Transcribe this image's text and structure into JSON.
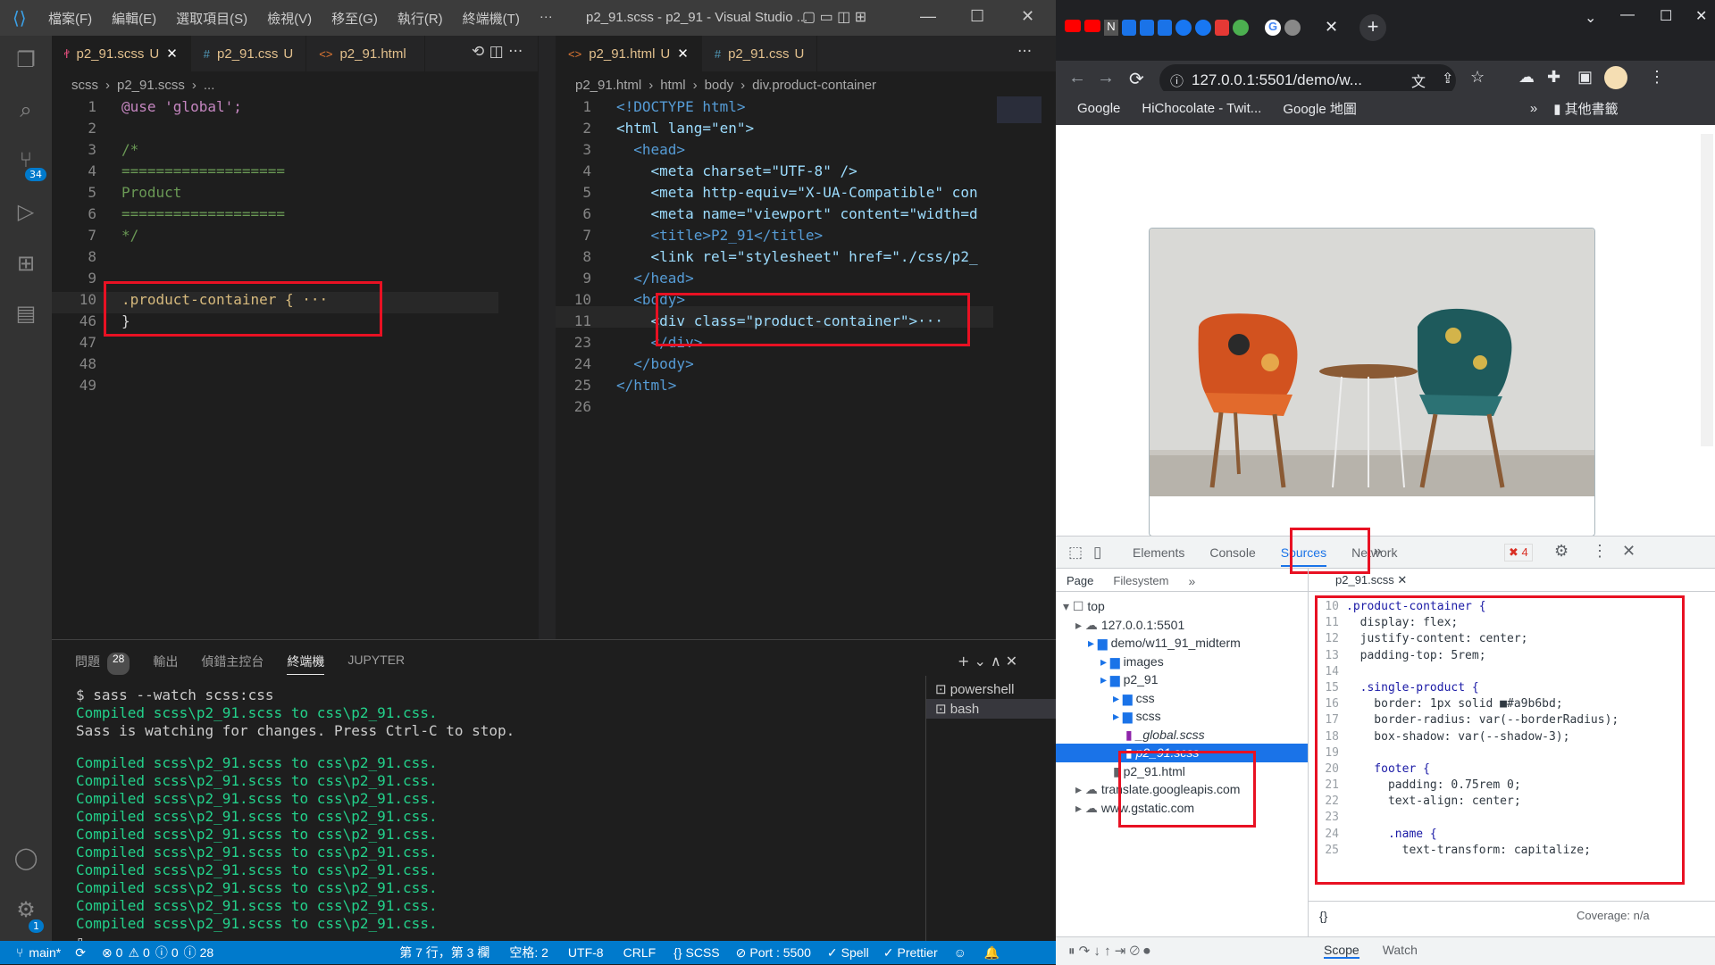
{
  "vscode": {
    "menu": [
      "檔案(F)",
      "編輯(E)",
      "選取項目(S)",
      "檢視(V)",
      "移至(G)",
      "執行(R)",
      "終端機(T)",
      "···"
    ],
    "title": "p2_91.scss - p2_91 - Visual Studio ...",
    "scm_badge": "34",
    "settings_badge": "1",
    "left_tabs": [
      {
        "icon": "ꬷ",
        "label": "p2_91.scss",
        "suffix": "U"
      },
      {
        "icon": "#",
        "label": "p2_91.css",
        "suffix": "U"
      },
      {
        "icon": "<>",
        "label": "p2_91.html",
        "suffix": ""
      }
    ],
    "right_tabs": [
      {
        "icon": "<>",
        "label": "p2_91.html",
        "suffix": "U"
      },
      {
        "icon": "#",
        "label": "p2_91.css",
        "suffix": "U"
      }
    ],
    "left_breadcrumb": [
      "scss",
      "p2_91.scss",
      "..."
    ],
    "right_breadcrumb": [
      "p2_91.html",
      "html",
      "body",
      "div.product-container"
    ],
    "left_lines": [
      {
        "n": "1",
        "t": "@use 'global';"
      },
      {
        "n": "2",
        "t": ""
      },
      {
        "n": "3",
        "t": "/*"
      },
      {
        "n": "4",
        "t": "==================="
      },
      {
        "n": "5",
        "t": "Product"
      },
      {
        "n": "6",
        "t": "==================="
      },
      {
        "n": "7",
        "t": "*/"
      },
      {
        "n": "8",
        "t": ""
      },
      {
        "n": "9",
        "t": ""
      },
      {
        "n": "10",
        "t": ".product-container { ···"
      },
      {
        "n": "46",
        "t": "}"
      },
      {
        "n": "47",
        "t": ""
      },
      {
        "n": "48",
        "t": ""
      },
      {
        "n": "49",
        "t": ""
      }
    ],
    "right_lines": [
      {
        "n": "1",
        "t": "<!DOCTYPE html>"
      },
      {
        "n": "2",
        "t": "<html lang=\"en\">"
      },
      {
        "n": "3",
        "t": "  <head>"
      },
      {
        "n": "4",
        "t": "    <meta charset=\"UTF-8\" />"
      },
      {
        "n": "5",
        "t": "    <meta http-equiv=\"X-UA-Compatible\" con"
      },
      {
        "n": "6",
        "t": "    <meta name=\"viewport\" content=\"width=d"
      },
      {
        "n": "7",
        "t": "    <title>P2_91</title>"
      },
      {
        "n": "8",
        "t": "    <link rel=\"stylesheet\" href=\"./css/p2_"
      },
      {
        "n": "9",
        "t": "  </head>"
      },
      {
        "n": "10",
        "t": "  <body>"
      },
      {
        "n": "11",
        "t": "    <div class=\"product-container\">···"
      },
      {
        "n": "23",
        "t": "    </div>"
      },
      {
        "n": "24",
        "t": "  </body>"
      },
      {
        "n": "25",
        "t": "</html>"
      },
      {
        "n": "26",
        "t": ""
      }
    ],
    "panel_tabs": [
      "問題",
      "輸出",
      "偵錯主控台",
      "終端機",
      "JUPYTER"
    ],
    "problems_count": "28",
    "terminal_lines": [
      {
        "t": "$ sass --watch scss:css",
        "c": "white"
      },
      {
        "t": "Compiled scss\\p2_91.scss to css\\p2_91.css.",
        "c": "green"
      },
      {
        "t": "Sass is watching for changes. Press Ctrl-C to stop.",
        "c": "white"
      },
      {
        "t": "",
        "c": "white"
      },
      {
        "t": "Compiled scss\\p2_91.scss to css\\p2_91.css.",
        "c": "green"
      },
      {
        "t": "Compiled scss\\p2_91.scss to css\\p2_91.css.",
        "c": "green"
      },
      {
        "t": "Compiled scss\\p2_91.scss to css\\p2_91.css.",
        "c": "green"
      },
      {
        "t": "Compiled scss\\p2_91.scss to css\\p2_91.css.",
        "c": "green"
      },
      {
        "t": "Compiled scss\\p2_91.scss to css\\p2_91.css.",
        "c": "green"
      },
      {
        "t": "Compiled scss\\p2_91.scss to css\\p2_91.css.",
        "c": "green"
      },
      {
        "t": "Compiled scss\\p2_91.scss to css\\p2_91.css.",
        "c": "green"
      },
      {
        "t": "Compiled scss\\p2_91.scss to css\\p2_91.css.",
        "c": "green"
      },
      {
        "t": "Compiled scss\\p2_91.scss to css\\p2_91.css.",
        "c": "green"
      },
      {
        "t": "Compiled scss\\p2_91.scss to css\\p2_91.css.",
        "c": "green"
      }
    ],
    "terminals": [
      "powershell",
      "bash"
    ],
    "status": {
      "branch": "main*",
      "errors": "0",
      "warnings": "0",
      "info": "0",
      "info2": "28",
      "position": "第 7 行，第 3 欄",
      "spaces": "空格: 2",
      "encoding": "UTF-8",
      "eol": "CRLF",
      "lang": "SCSS",
      "port": "Port : 5500",
      "spell": "Spell",
      "prettier": "Prettier"
    }
  },
  "chrome": {
    "address": "127.0.0.1:5501/demo/w...",
    "bookmarks": [
      "Google",
      "HiChocolate - Twit...",
      "Google 地圖"
    ],
    "other_bookmarks": "其他書籤",
    "devtools_tabs": [
      "Elements",
      "Console",
      "Sources",
      "Network"
    ],
    "error_count": "4",
    "nav_tabs": [
      "Page",
      "Filesystem"
    ],
    "open_file": "p2_91.scss",
    "tree": [
      {
        "label": "top",
        "depth": 0,
        "kind": "frame"
      },
      {
        "label": "127.0.0.1:5501",
        "depth": 1,
        "kind": "cloud"
      },
      {
        "label": "demo/w11_91_midterm",
        "depth": 2,
        "kind": "folder"
      },
      {
        "label": "images",
        "depth": 3,
        "kind": "folder"
      },
      {
        "label": "p2_91",
        "depth": 3,
        "kind": "folder"
      },
      {
        "label": "css",
        "depth": 4,
        "kind": "folder"
      },
      {
        "label": "scss",
        "depth": 4,
        "kind": "folder"
      },
      {
        "label": "_global.scss",
        "depth": 5,
        "kind": "scss"
      },
      {
        "label": "p2_91.scss",
        "depth": 5,
        "kind": "scss-selected"
      },
      {
        "label": "p2_91.html",
        "depth": 4,
        "kind": "file"
      },
      {
        "label": "translate.googleapis.com",
        "depth": 1,
        "kind": "cloud"
      },
      {
        "label": "www.gstatic.com",
        "depth": 1,
        "kind": "cloud"
      }
    ],
    "source_lines": [
      {
        "n": "10",
        "t": ".product-container {"
      },
      {
        "n": "11",
        "t": "  display: flex;"
      },
      {
        "n": "12",
        "t": "  justify-content: center;"
      },
      {
        "n": "13",
        "t": "  padding-top: 5rem;"
      },
      {
        "n": "14",
        "t": ""
      },
      {
        "n": "15",
        "t": "  .single-product {"
      },
      {
        "n": "16",
        "t": "    border: 1px solid ■#a9b6bd;"
      },
      {
        "n": "17",
        "t": "    border-radius: var(--borderRadius);"
      },
      {
        "n": "18",
        "t": "    box-shadow: var(--shadow-3);"
      },
      {
        "n": "19",
        "t": ""
      },
      {
        "n": "20",
        "t": "    footer {"
      },
      {
        "n": "21",
        "t": "      padding: 0.75rem 0;"
      },
      {
        "n": "22",
        "t": "      text-align: center;"
      },
      {
        "n": "23",
        "t": ""
      },
      {
        "n": "24",
        "t": "      .name {"
      },
      {
        "n": "25",
        "t": "        text-transform: capitalize;"
      }
    ],
    "coverage": "Coverage: n/a",
    "bottom_tabs": [
      "Scope",
      "Watch"
    ]
  }
}
